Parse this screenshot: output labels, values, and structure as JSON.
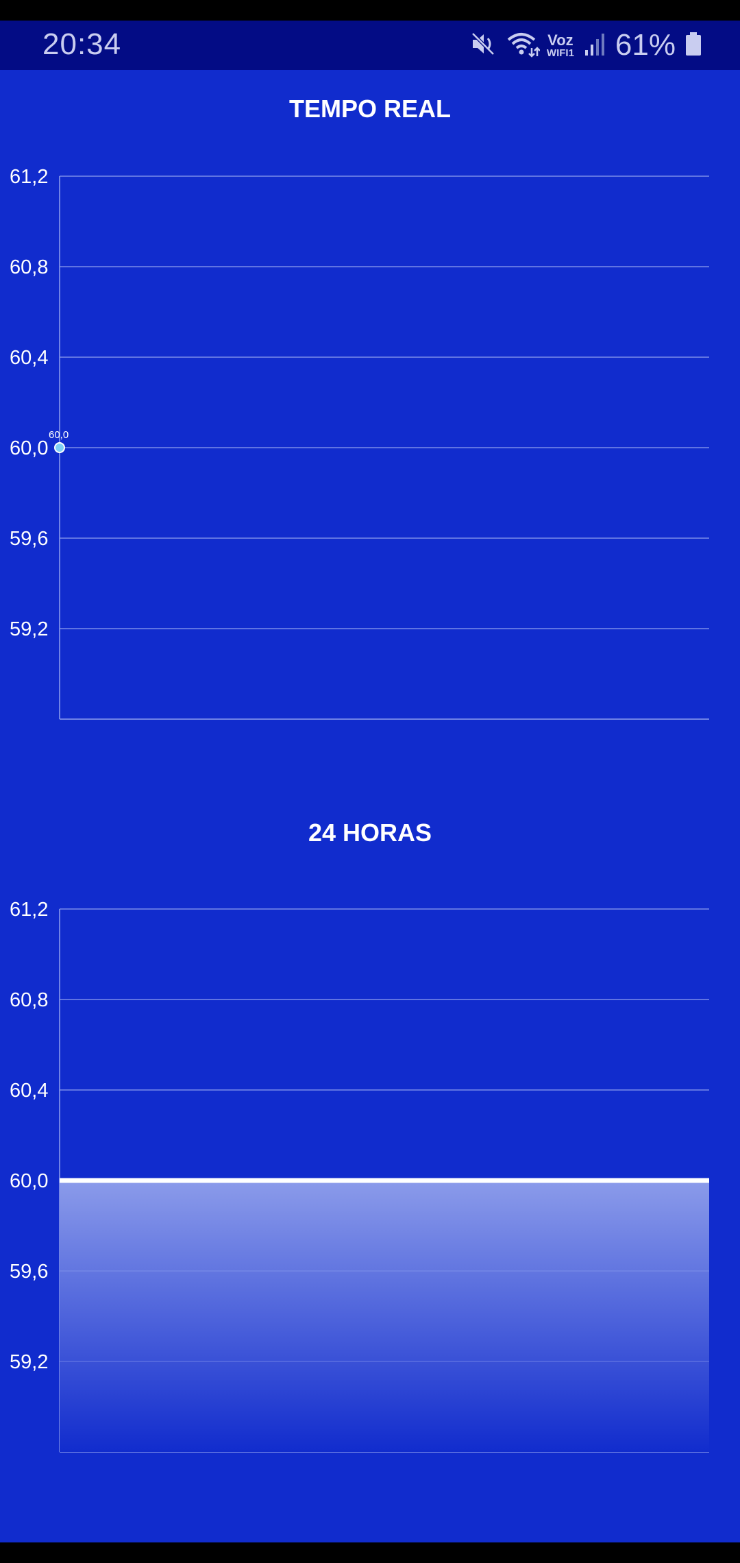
{
  "status_bar": {
    "time": "20:34",
    "icons": [
      "mute-icon",
      "wifi-calling-icon",
      "signal-icon",
      "battery-icon"
    ],
    "voz": "Voz",
    "wifi_label": "WIFI1",
    "battery": "61%"
  },
  "colors": {
    "background": "#112ccd",
    "status_bar": "#030c85",
    "grid": "#8fa0ee",
    "line": "#ffffff",
    "area_top": "#8b9bea",
    "point_fill": "#7fd0f5"
  },
  "charts": {
    "realtime": {
      "title": "TEMPO REAL"
    },
    "day": {
      "title": "24 HORAS"
    }
  },
  "chart_data": [
    {
      "type": "line",
      "title": "TEMPO REAL",
      "y_ticks": [
        "61,2",
        "60,8",
        "60,4",
        "60,0",
        "59,6",
        "59,2"
      ],
      "ylim": [
        58.8,
        61.2
      ],
      "series": [
        {
          "values": [
            60.0
          ]
        }
      ],
      "data_labels": [
        "60,0"
      ],
      "grid": true
    },
    {
      "type": "area",
      "title": "24 HORAS",
      "y_ticks": [
        "61,2",
        "60,8",
        "60,4",
        "60,0",
        "59,6",
        "59,2"
      ],
      "ylim": [
        58.8,
        61.2
      ],
      "series": [
        {
          "values": [
            60.0,
            60.0
          ]
        }
      ],
      "grid": true
    }
  ]
}
